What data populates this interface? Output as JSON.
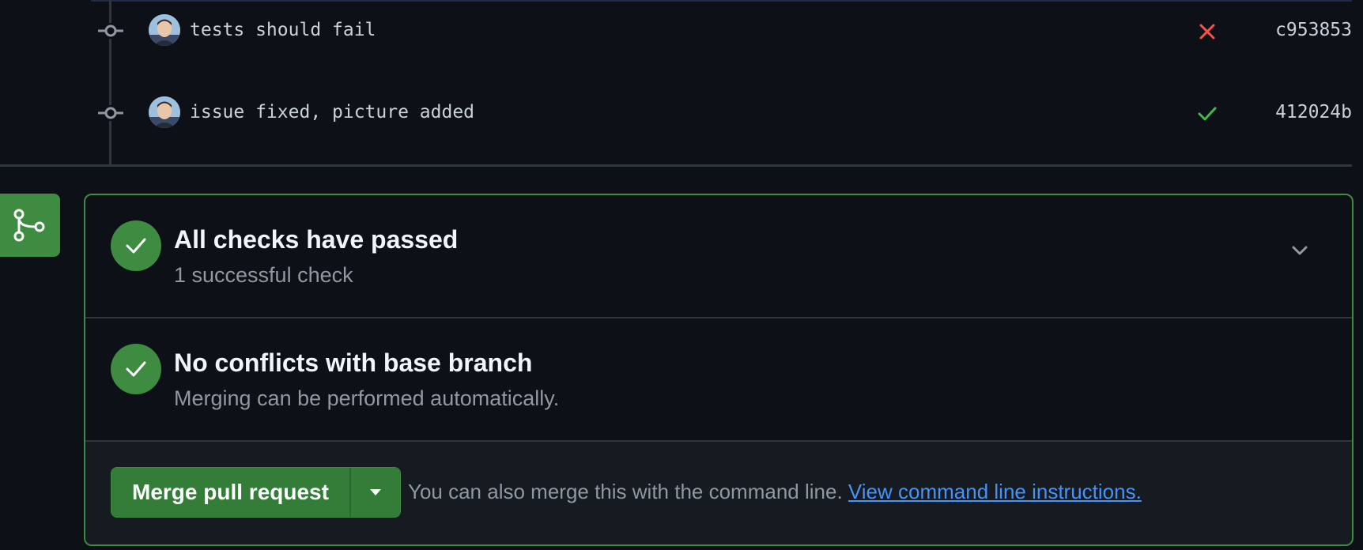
{
  "commits": [
    {
      "message": "tests should fail",
      "sha": "c953853",
      "status": "failure",
      "status_icon": "x-icon",
      "status_color": "#f85149"
    },
    {
      "message": "issue fixed, picture added",
      "sha": "412024b",
      "status": "success",
      "status_icon": "check-icon",
      "status_color": "#3fb950"
    }
  ],
  "merge_panel": {
    "badge_icon": "git-merge-icon",
    "accent_color": "#3e8c41",
    "checks": {
      "title": "All checks have passed",
      "subtitle": "1 successful check",
      "icon": "check-circle-icon",
      "toggle_icon": "chevron-down-icon"
    },
    "conflicts": {
      "title": "No conflicts with base branch",
      "subtitle": "Merging can be performed automatically.",
      "icon": "check-circle-icon"
    },
    "action": {
      "merge_button_label": "Merge pull request",
      "dropdown_icon": "triangle-down-icon",
      "helper_text": "You can also merge this with the command line. ",
      "link_text": "View command line instructions."
    }
  }
}
